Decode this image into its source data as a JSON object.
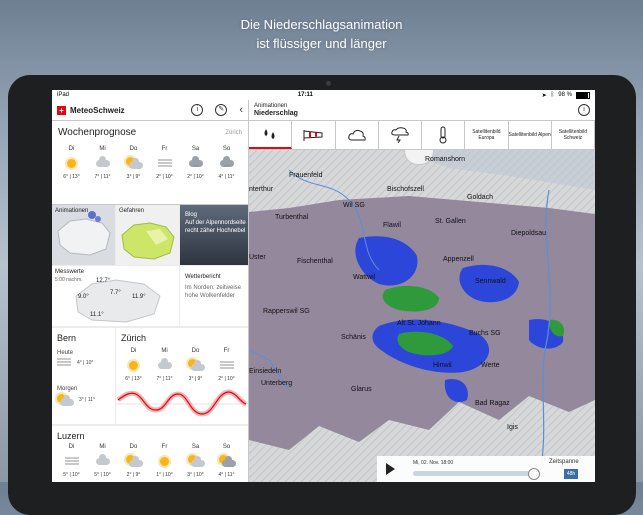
{
  "headline": {
    "line1": "Die Niederschlagsanimation",
    "line2": "ist flüssiger und länger"
  },
  "statusbar": {
    "device": "iPad",
    "time": "17:11",
    "battery": "98 %"
  },
  "left_panel": {
    "app_name": "MeteoSchweiz",
    "wochenprognose": {
      "title": "Wochenprognose",
      "location": "Zürich",
      "days": [
        {
          "name": "Di",
          "temp": "6° | 13°",
          "icon": "sun"
        },
        {
          "name": "Mi",
          "temp": "7° | 11°",
          "icon": "cloud"
        },
        {
          "name": "Do",
          "temp": "3° | 9°",
          "icon": "suncloud"
        },
        {
          "name": "Fr",
          "temp": "2° | 10°",
          "icon": "fog"
        },
        {
          "name": "Sa",
          "temp": "2° | 10°",
          "icon": "rain"
        },
        {
          "name": "So",
          "temp": "4° | 11°",
          "icon": "rain"
        }
      ]
    },
    "tiles": {
      "animation": "Animationen",
      "gefahren": "Gefahren",
      "blog": "Blog\nAuf der Alpennordseite recht zäher Hochnebel",
      "messwerte": "Messwerte",
      "messwerte_time": "5:00 nachm.",
      "map_values": [
        "12.7°",
        "7.7°",
        "9.0°",
        "11.9°",
        "11.1°"
      ],
      "wetterbericht_title": "Wetterbericht",
      "wetterbericht_text": "Im Norden: zeitweise hohe Wolkenfelder"
    },
    "bern": {
      "title": "Bern",
      "rows": [
        {
          "label": "Heute",
          "temp": "4° | 10°"
        },
        {
          "label": "Morgen",
          "temp": "3° | 11°"
        }
      ]
    },
    "zuerich": {
      "title": "Zürich",
      "days": [
        {
          "name": "Di",
          "temp": "6° | 13°"
        },
        {
          "name": "Mi",
          "temp": "7° | 11°"
        },
        {
          "name": "Do",
          "temp": "3° | 9°"
        },
        {
          "name": "Fr",
          "temp": "2° | 10°"
        }
      ]
    },
    "luzern": {
      "title": "Luzern",
      "days": [
        {
          "name": "Di",
          "temp": "5° | 10°"
        },
        {
          "name": "Mi",
          "temp": "5° | 10°"
        },
        {
          "name": "Do",
          "temp": "2° | 9°"
        },
        {
          "name": "Fr",
          "temp": "1° | 10°"
        },
        {
          "name": "Sa",
          "temp": "3° | 10°"
        },
        {
          "name": "So",
          "temp": "4° | 11°"
        }
      ]
    }
  },
  "right_panel": {
    "title_small": "Animationen",
    "title": "Niederschlag",
    "tools": [
      {
        "label": "",
        "icon": "rain-drops-icon"
      },
      {
        "label": "",
        "icon": "wind-sock-icon"
      },
      {
        "label": "",
        "icon": "cloud-icon"
      },
      {
        "label": "",
        "icon": "thunderstorm-icon"
      },
      {
        "label": "",
        "icon": "thermometer-icon"
      },
      {
        "label": "Satellitenbild Europa",
        "icon": ""
      },
      {
        "label": "Satellitenbild Alpen",
        "icon": ""
      },
      {
        "label": "Satellitenbild Schweiz",
        "icon": ""
      }
    ],
    "map_labels": [
      "Romanshorn",
      "Frauenfeld",
      "Bischofszell",
      "Goldach",
      "nterthur",
      "Wil SG",
      "Turbenthal",
      "Flawil",
      "St. Gallen",
      "Diepoldsau",
      "Uster",
      "Fischenthal",
      "Appenzell",
      "Wattwil",
      "Sennwald",
      "Rapperswil SG",
      "Alt St. Johann",
      "Schänis",
      "Buchs SG",
      "Einsiedeln",
      "Hinwil",
      "Werte",
      "Glarus",
      "Unterberg",
      "Bad Ragaz",
      "Igis"
    ],
    "player": {
      "time": "Mi, 02. Nov. 18:00",
      "span_label": "Zeitspanne",
      "span_value": "48h"
    }
  },
  "colors": {
    "accent": "#e30613",
    "rain_light": "#8d7f96",
    "rain_mid": "#2b46d9",
    "rain_heavy": "#2f9a3b"
  }
}
